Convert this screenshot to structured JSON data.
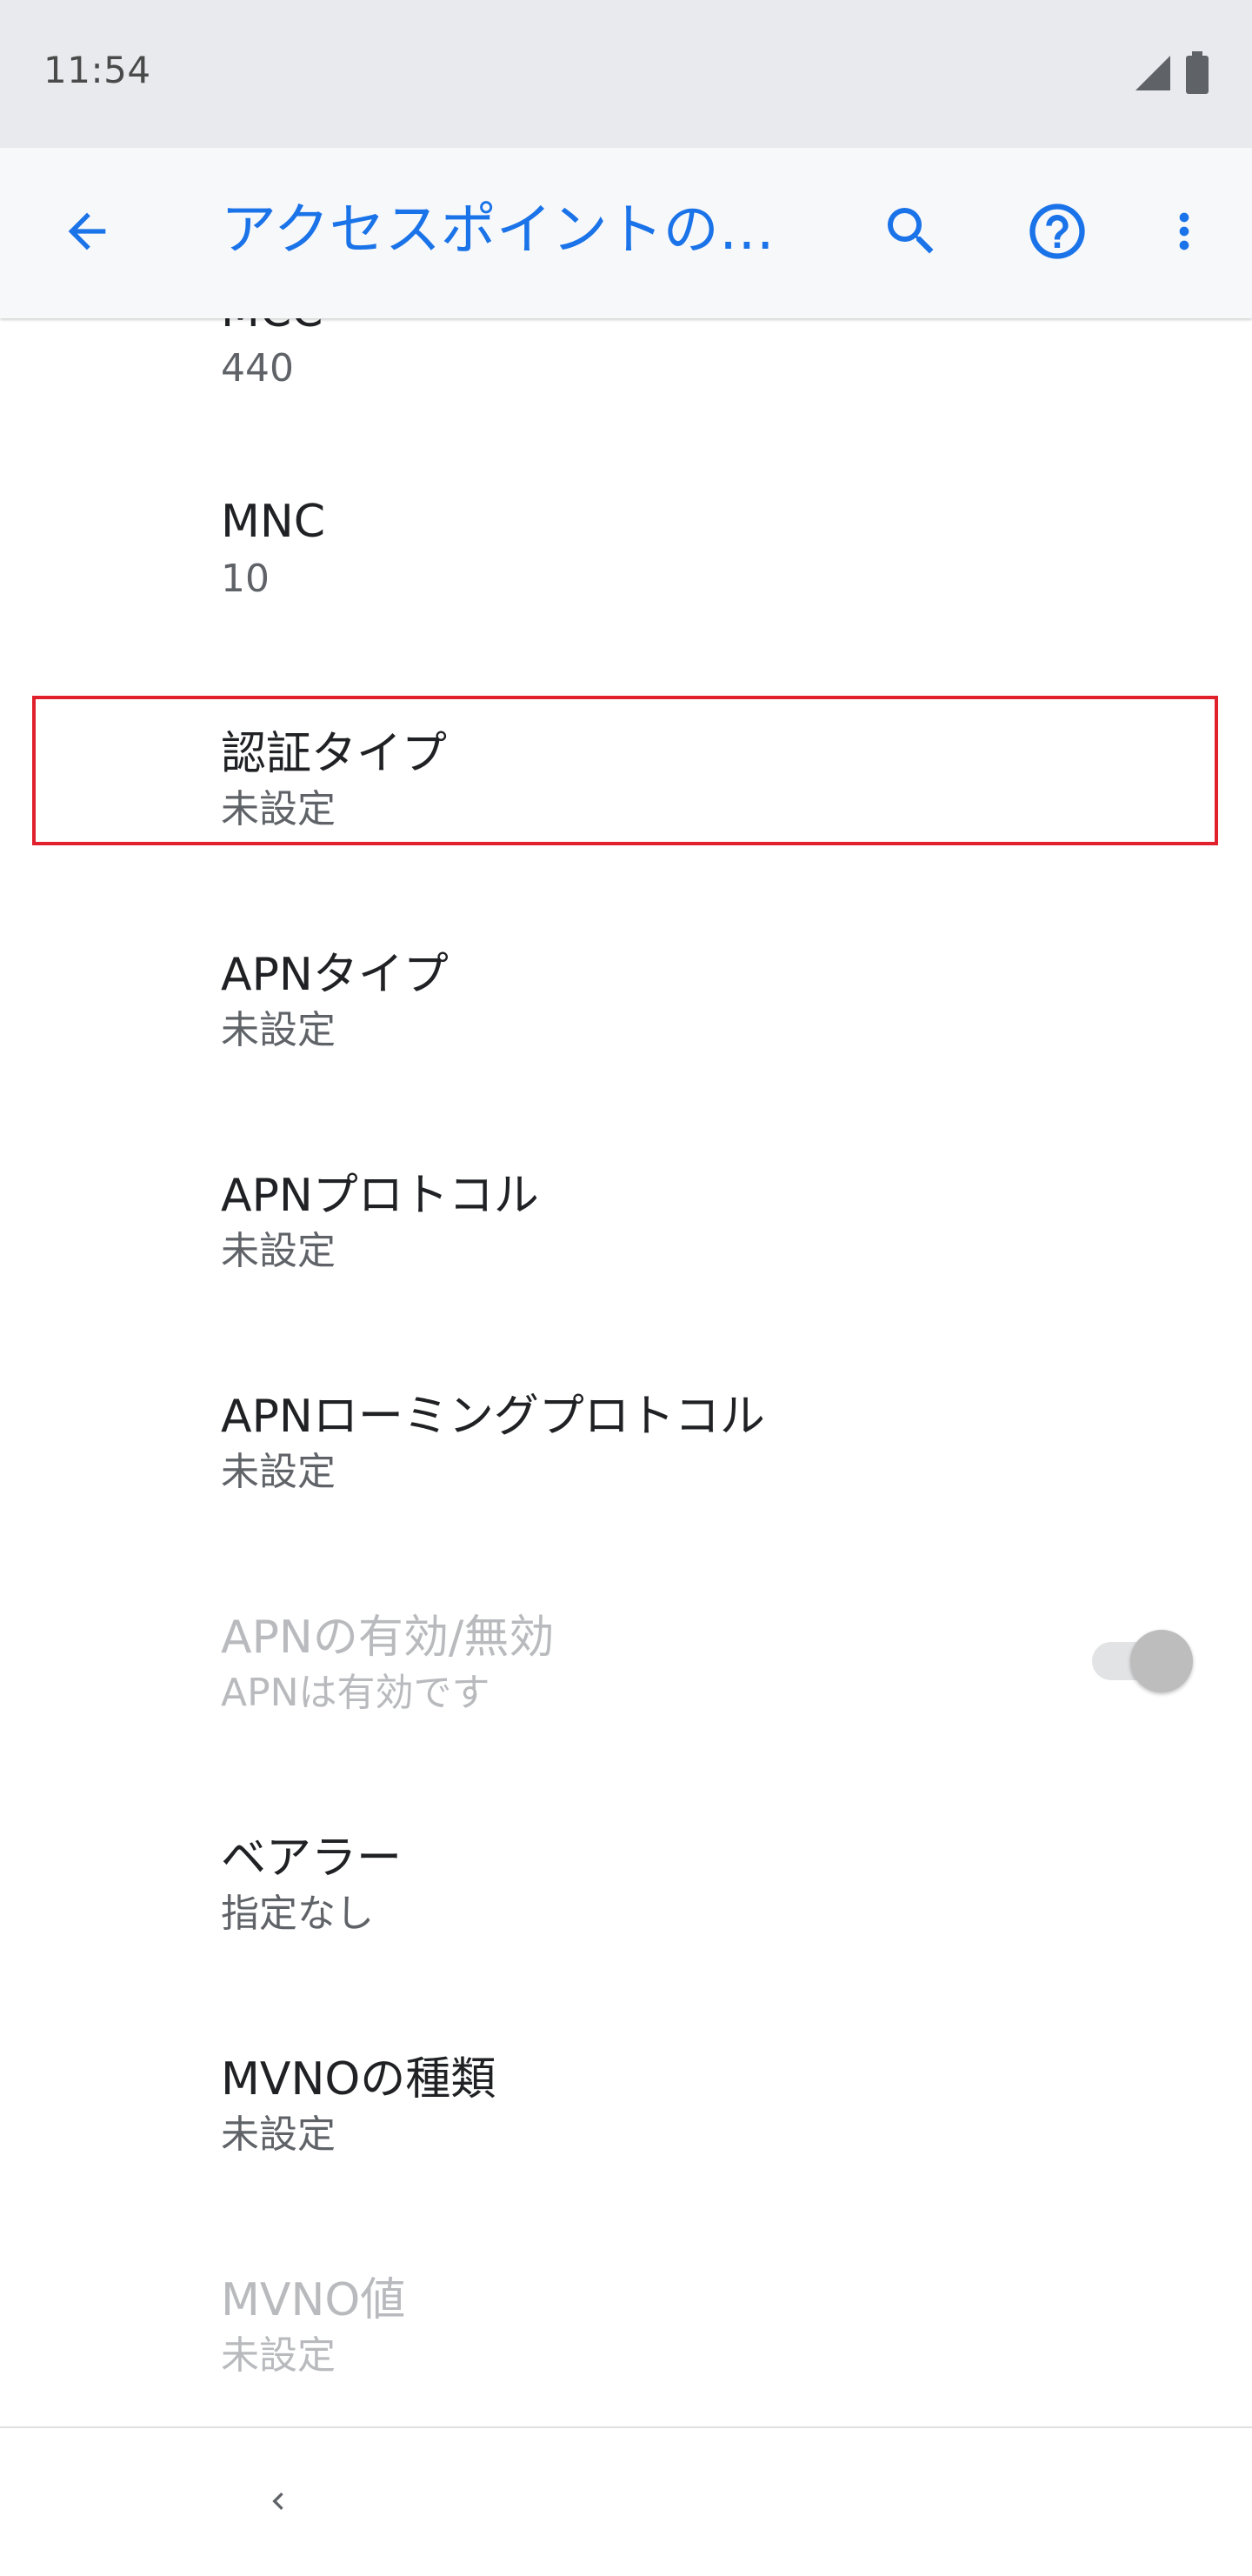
{
  "status_bar": {
    "time": "11:54"
  },
  "app_bar": {
    "title": "アクセスポイントの編集"
  },
  "colors": {
    "accent": "#1a73e8",
    "highlight": "#e0202c",
    "disabled_text": "#b8babd"
  },
  "icons": {
    "back": "arrow-left-icon",
    "search": "search-icon",
    "help": "help-circle-icon",
    "more": "more-vert-icon",
    "signal": "cell-signal-icon",
    "battery": "battery-icon",
    "nav_back": "chevron-left-icon"
  },
  "settings": [
    {
      "title": "MCC",
      "summary": "440",
      "enabled": true
    },
    {
      "title": "MNC",
      "summary": "10",
      "enabled": true
    },
    {
      "title": "認証タイプ",
      "summary": "未設定",
      "enabled": true,
      "highlighted": true
    },
    {
      "title": "APNタイプ",
      "summary": "未設定",
      "enabled": true
    },
    {
      "title": "APNプロトコル",
      "summary": "未設定",
      "enabled": true
    },
    {
      "title": "APNローミングプロトコル",
      "summary": "未設定",
      "enabled": true
    },
    {
      "title": "APNの有効/無効",
      "summary": "APNは有効です",
      "enabled": false,
      "toggle_on": true
    },
    {
      "title": "ベアラー",
      "summary": "指定なし",
      "enabled": true
    },
    {
      "title": "MVNOの種類",
      "summary": "未設定",
      "enabled": true
    },
    {
      "title": "MVNO値",
      "summary": "未設定",
      "enabled": false
    }
  ]
}
